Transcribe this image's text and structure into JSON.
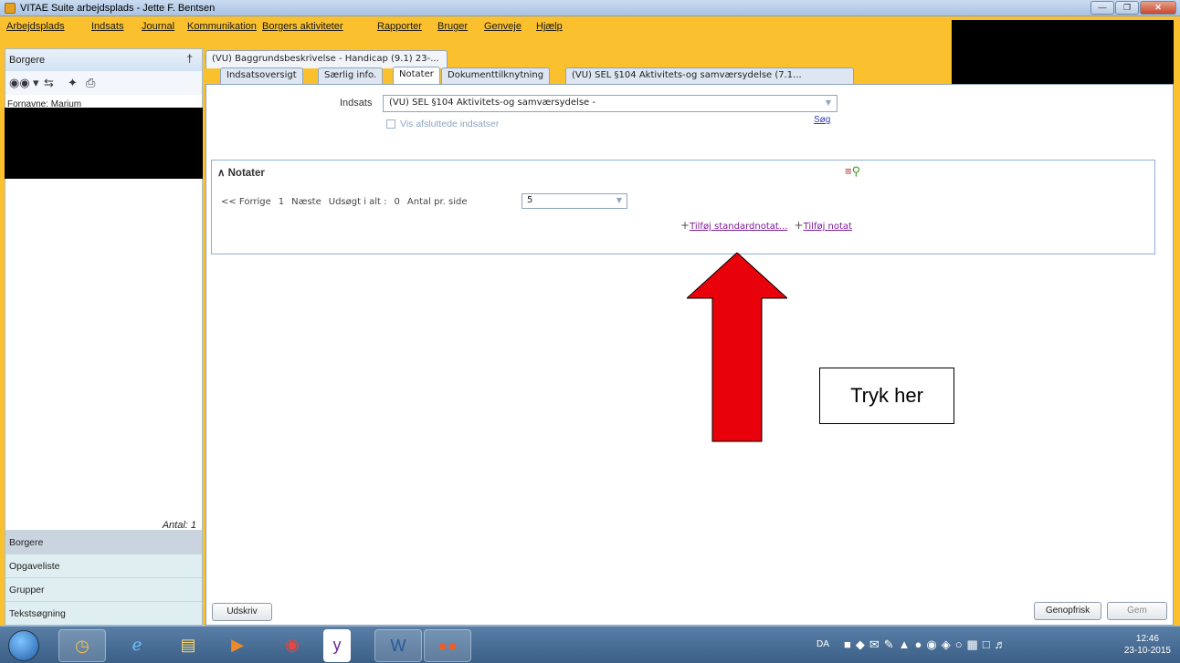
{
  "window": {
    "title": "VITAE Suite arbejdsplads - Jette F. Bentsen"
  },
  "menu": [
    "Arbejdsplads",
    "Indsats",
    "Journal",
    "Kommunikation",
    "Borgers aktiviteter",
    "Rapporter",
    "Bruger",
    "Genveje",
    "Hjælp"
  ],
  "left_panel": {
    "header": "Borgere",
    "citizen_name": "Fornavne: Marium",
    "count": "Antal: 1",
    "nav": [
      "Borgere",
      "Opgaveliste",
      "Grupper",
      "Tekstsøgning"
    ]
  },
  "document_tab": "(VU) Baggrundsbeskrivelse - Handicap (9.1) 23-...",
  "subtabs": [
    "Indsatsoversigt",
    "Særlig info.",
    "Notater",
    "Dokumenttilknytning",
    "(VU) SEL §104 Aktivitets-og samværsydelse (7.1..."
  ],
  "active_subtab": "Notater",
  "form": {
    "indsats_label": "Indsats",
    "indsats_value": "(VU) SEL §104 Aktivitets-og samværsydelse -",
    "checkbox_label": "Vis afsluttede indsatser",
    "search_link": "Søg"
  },
  "notes": {
    "title": "Notater",
    "pager": {
      "prev": "<<  Forrige",
      "page": "1",
      "next": "Næste",
      "found_label": "Udsøgt i alt :",
      "found": "0",
      "per_page_label": "Antal pr. side",
      "per_page": "5"
    },
    "add_standard": "Tilføj standardnotat...",
    "add_note": "Tilføj notat"
  },
  "buttons": {
    "print": "Udskriv",
    "refresh": "Genopfrisk",
    "save": "Gem"
  },
  "annotation": {
    "callout": "Tryk her",
    "arrow_color": "#e8000b"
  },
  "taskbar": {
    "language": "DA",
    "time": "12:46",
    "date": "23-10-2015"
  }
}
